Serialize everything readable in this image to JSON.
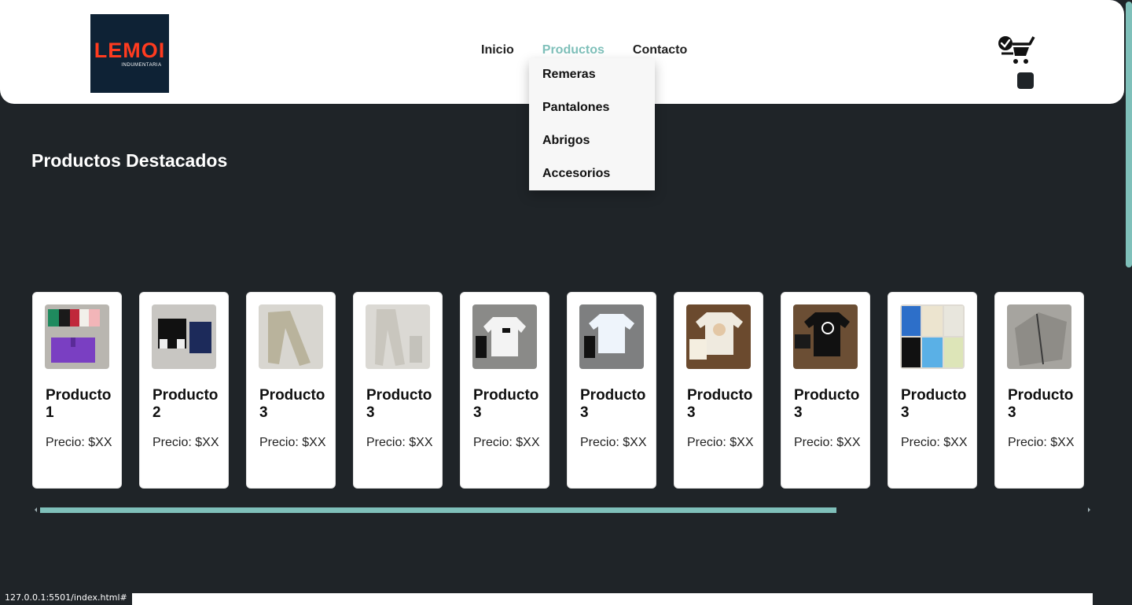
{
  "brand": {
    "logo_text": "LEMOI",
    "logo_subtext": "INDUMENTARIA"
  },
  "nav": {
    "items": [
      {
        "label": "Inicio",
        "active": false
      },
      {
        "label": "Productos",
        "active": true
      },
      {
        "label": "Contacto",
        "active": false
      }
    ],
    "dropdown": [
      "Remeras",
      "Pantalones",
      "Abrigos",
      "Accesorios"
    ]
  },
  "icons": {
    "cart": "shopping-cart-check-icon"
  },
  "section": {
    "title": "Productos Destacados"
  },
  "products": [
    {
      "name": "Producto 1",
      "price": "Precio: $XX"
    },
    {
      "name": "Producto 2",
      "price": "Precio: $XX"
    },
    {
      "name": "Producto 3",
      "price": "Precio: $XX"
    },
    {
      "name": "Producto 3",
      "price": "Precio: $XX"
    },
    {
      "name": "Producto 3",
      "price": "Precio: $XX"
    },
    {
      "name": "Producto 3",
      "price": "Precio: $XX"
    },
    {
      "name": "Producto 3",
      "price": "Precio: $XX"
    },
    {
      "name": "Producto 3",
      "price": "Precio: $XX"
    },
    {
      "name": "Producto 3",
      "price": "Precio: $XX"
    },
    {
      "name": "Producto 3",
      "price": "Precio: $XX"
    }
  ],
  "status_bar": {
    "url": "127.0.0.1:5501/index.html#"
  },
  "colors": {
    "accent": "#7fc0ba",
    "background": "#1f2428",
    "logo_bg": "#0e2235",
    "logo_text": "#ff3b1f"
  }
}
